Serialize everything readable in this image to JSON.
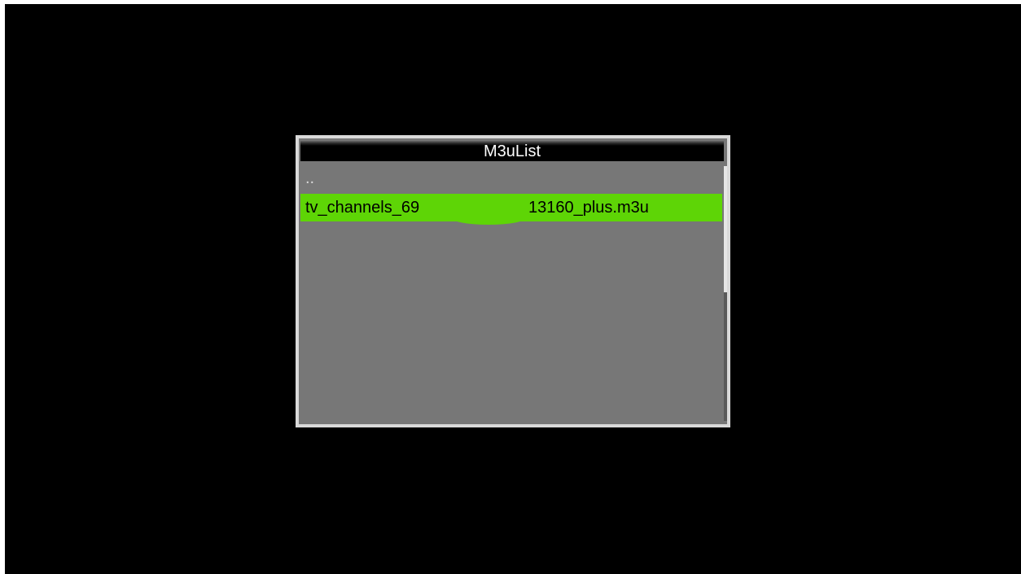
{
  "dialog": {
    "title": "M3uList",
    "items": [
      {
        "label": ".."
      },
      {
        "label": "tv_channels_69",
        "label_end": "13160_plus.m3u",
        "selected": true
      }
    ]
  },
  "colors": {
    "background": "#000000",
    "panel": "#777777",
    "frame": "#d9d9d9",
    "selection": "#5ed506",
    "title_bar": "#000000"
  },
  "scroll_position": 0.5
}
